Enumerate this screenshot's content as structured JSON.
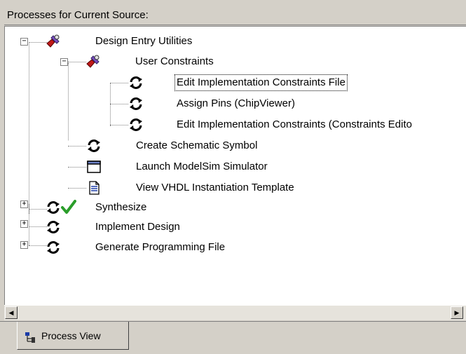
{
  "panel": {
    "title": "Processes for Current Source:"
  },
  "tree": {
    "design_entry": "Design Entry Utilities",
    "user_constraints": "User Constraints",
    "edit_impl_constraints": "Edit Implementation Constraints File",
    "assign_pins": "Assign Pins (ChipViewer)",
    "edit_impl_constraints_editor": "Edit Implementation Constraints (Constraints Edito",
    "create_schematic": "Create Schematic Symbol",
    "launch_modelsim": "Launch ModelSim Simulator",
    "view_vhdl": "View VHDL Instantiation Template",
    "synthesize": "Synthesize",
    "implement_design": "Implement Design",
    "generate_programming": "Generate Programming File"
  },
  "scrollbar": {
    "left_arrow": "◀",
    "right_arrow": "▶"
  },
  "tabs": {
    "process_view": "Process View"
  },
  "expanders": {
    "expanded": "−",
    "collapsed": "+"
  },
  "icons": {
    "tools": "tools-icon",
    "process": "process-refresh-icon",
    "check": "green-checkmark-icon",
    "window": "window-icon",
    "document": "document-icon"
  },
  "colors": {
    "selection": "#000000",
    "tree_lines": "#808080",
    "check_green": "#2a9d2a"
  }
}
